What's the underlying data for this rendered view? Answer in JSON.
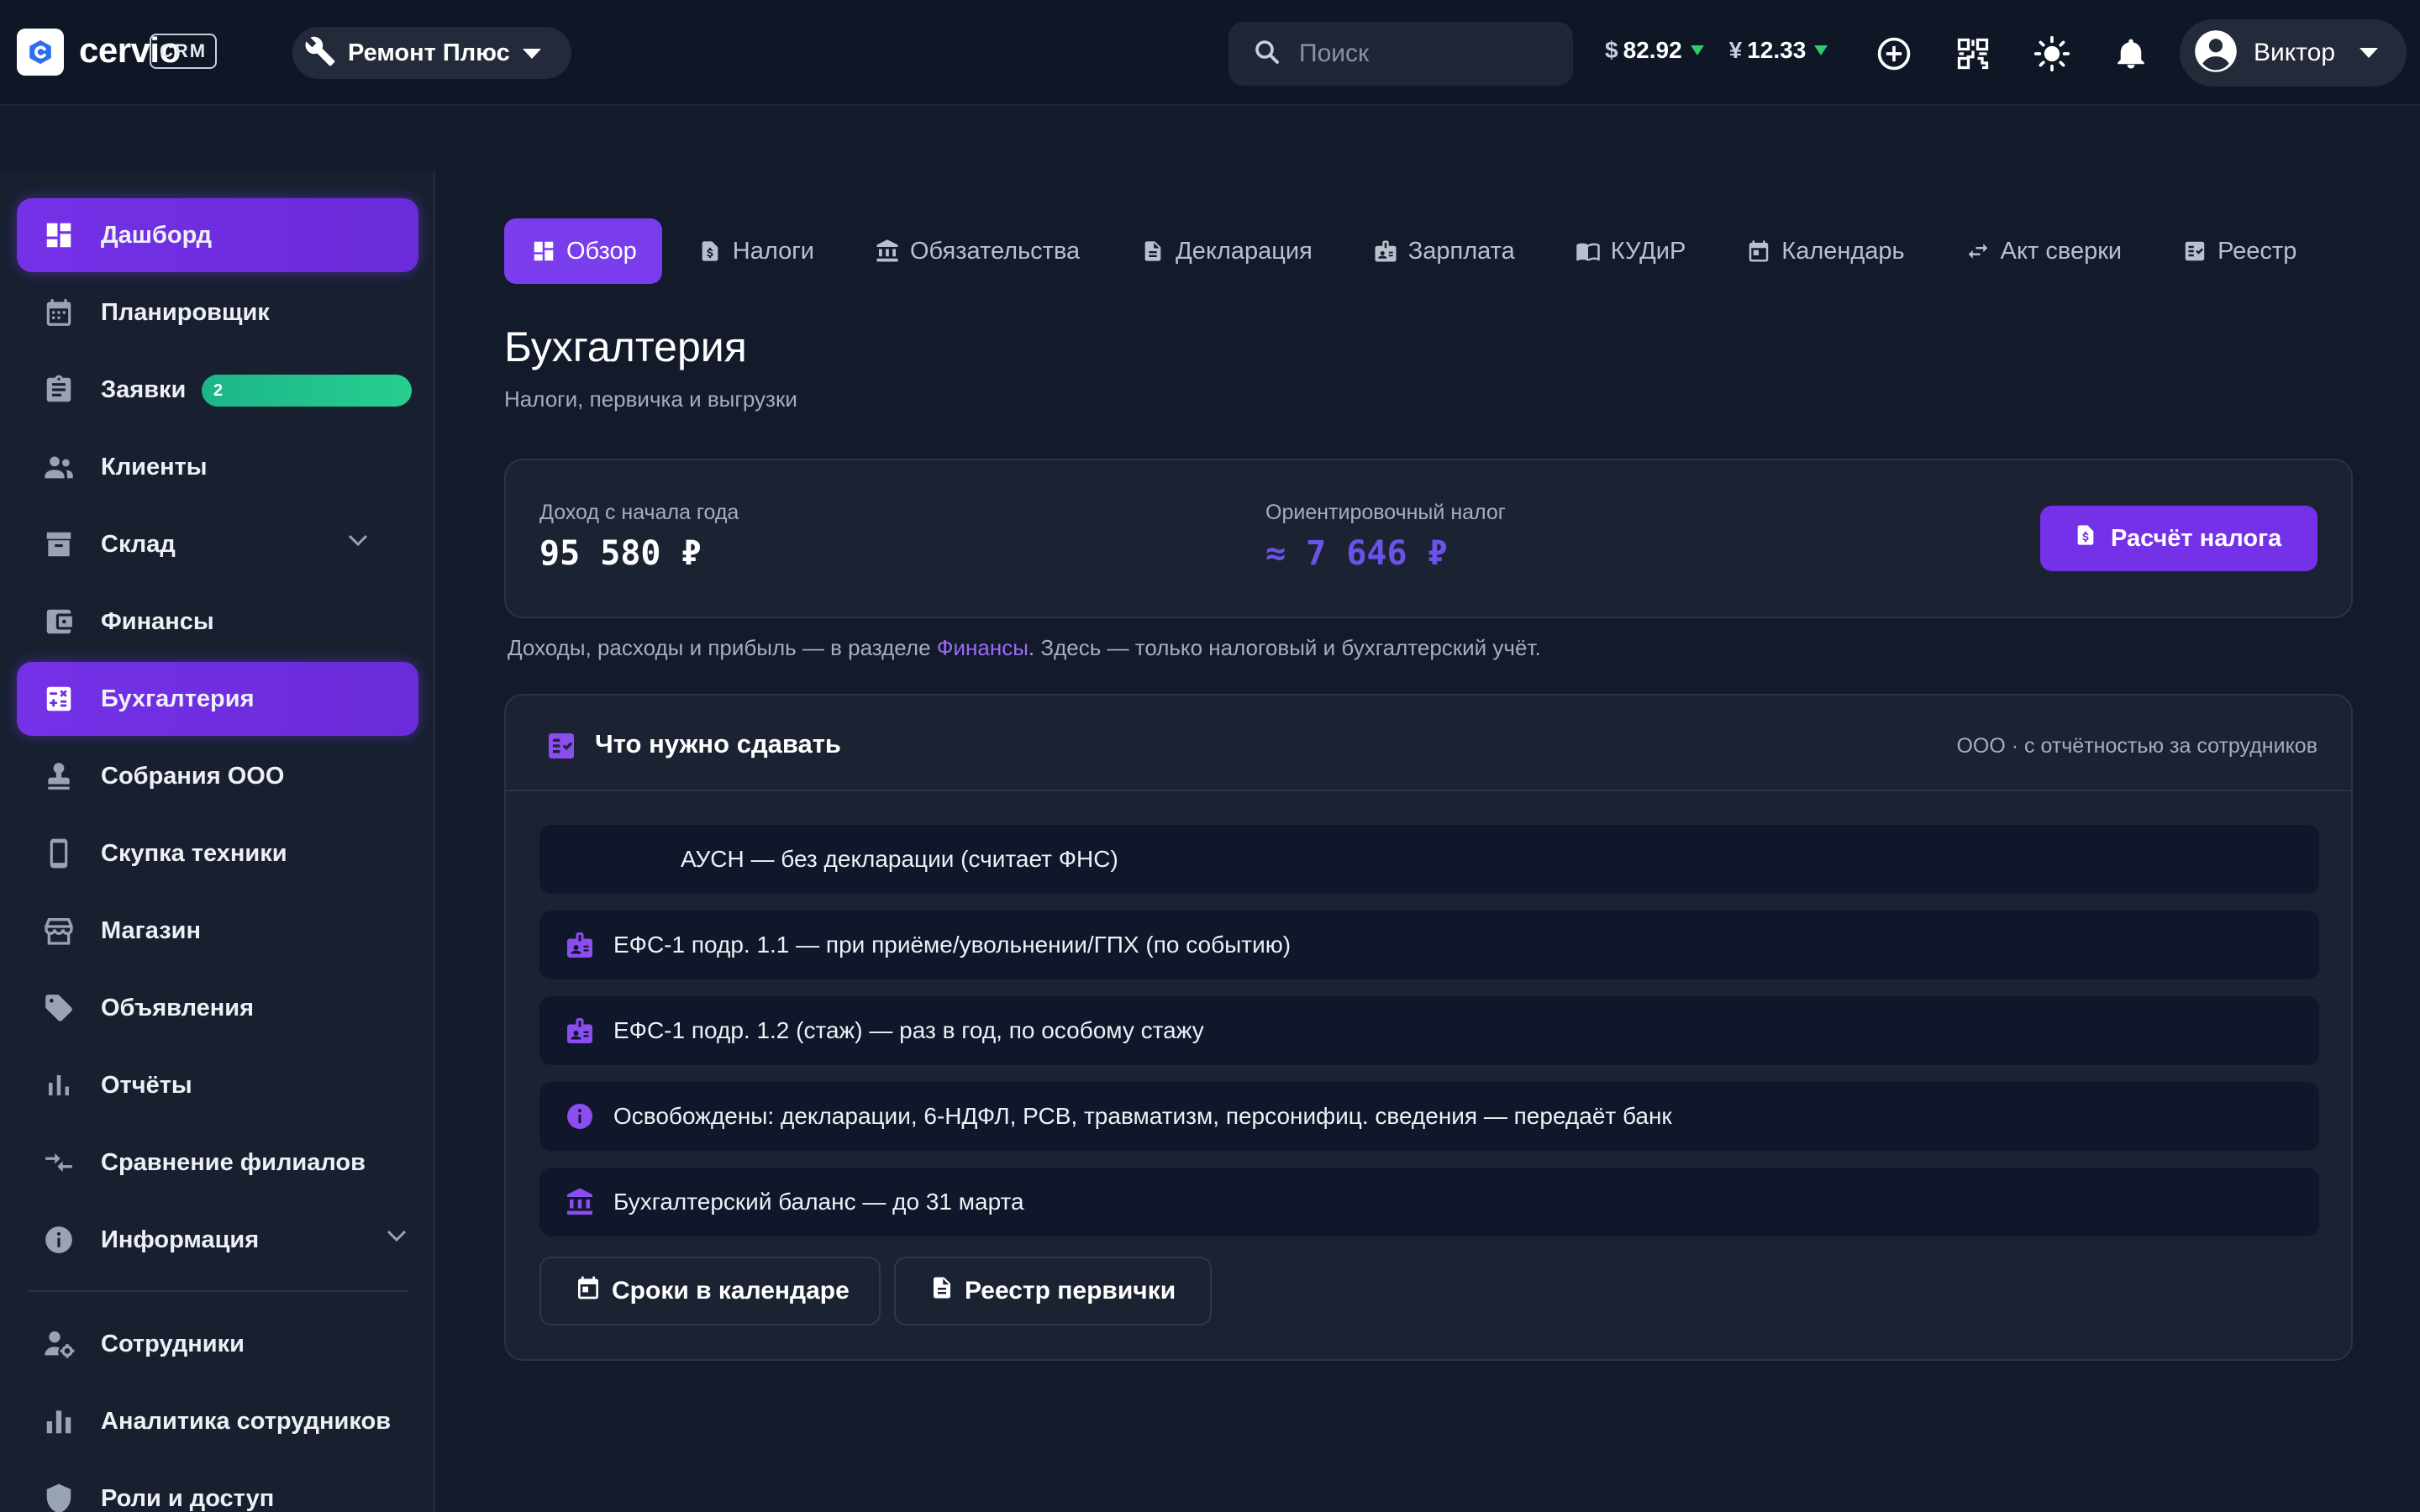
{
  "app": {
    "logo_text": "cervio",
    "badge": "CRM",
    "branch": "Ремонт Плюс",
    "search_placeholder": "Поиск",
    "rates": [
      {
        "symbol": "$",
        "value": "82.92",
        "trend": "down"
      },
      {
        "symbol": "¥",
        "value": "12.33",
        "trend": "down"
      }
    ],
    "user_name": "Виктор"
  },
  "sidebar": {
    "items": [
      {
        "label": "Дашборд",
        "icon": "dashboard-icon",
        "active": true
      },
      {
        "label": "Планировщик",
        "icon": "calendar-icon"
      },
      {
        "label": "Заявки",
        "icon": "clipboard-icon",
        "badge": "2"
      },
      {
        "label": "Клиенты",
        "icon": "people-icon"
      },
      {
        "label": "Склад",
        "icon": "archive-icon",
        "expandable": true
      },
      {
        "label": "Финансы",
        "icon": "wallet-icon"
      },
      {
        "label": "Бухгалтерия",
        "icon": "calculator-icon",
        "active": true
      },
      {
        "label": "Собрания ООО",
        "icon": "stamp-icon"
      },
      {
        "label": "Скупка техники",
        "icon": "phone-icon"
      },
      {
        "label": "Магазин",
        "icon": "store-icon"
      },
      {
        "label": "Объявления",
        "icon": "tag-icon"
      },
      {
        "label": "Отчёты",
        "icon": "bar-chart-icon"
      },
      {
        "label": "Сравнение филиалов",
        "icon": "compare-icon"
      },
      {
        "label": "Информация",
        "icon": "info-icon",
        "expandable": true
      },
      {
        "label": "Сотрудники",
        "icon": "staff-settings-icon"
      },
      {
        "label": "Аналитика сотрудников",
        "icon": "analytics-icon"
      },
      {
        "label": "Роли и доступ",
        "icon": "shield-icon"
      }
    ]
  },
  "tabs": [
    {
      "label": "Обзор",
      "icon": "dashboard-icon",
      "active": true
    },
    {
      "label": "Налоги",
      "icon": "tax-doc-icon"
    },
    {
      "label": "Обязательства",
      "icon": "bank-icon"
    },
    {
      "label": "Декларация",
      "icon": "document-icon"
    },
    {
      "label": "Зарплата",
      "icon": "badge-icon"
    },
    {
      "label": "КУДиР",
      "icon": "book-icon"
    },
    {
      "label": "Календарь",
      "icon": "calendar-icon"
    },
    {
      "label": "Акт сверки",
      "icon": "swap-icon"
    },
    {
      "label": "Реестр",
      "icon": "checklist-icon"
    }
  ],
  "page": {
    "title": "Бухгалтерия",
    "subtitle": "Налоги, первичка и выгрузки"
  },
  "kpi": {
    "income_label": "Доход с начала года",
    "income_value": "95 580 ₽",
    "tax_label": "Ориентировочный налог",
    "tax_value": "≈ 7 646 ₽",
    "calc_button": "Расчёт налога"
  },
  "note": {
    "before": "Доходы, расходы и прибыль — в разделе ",
    "link": "Финансы",
    "after": ". Здесь — только налоговый и бухгалтерский учёт."
  },
  "requirements": {
    "title": "Что нужно сдавать",
    "meta": "ООО · с отчётностью за сотрудников",
    "rows": [
      {
        "text": "АУСН — без декларации (считает ФНС)",
        "icon": ""
      },
      {
        "text": "ЕФС-1 подр. 1.1 — при приёме/увольнении/ГПХ (по событию)",
        "icon": "badge-icon"
      },
      {
        "text": "ЕФС-1 подр. 1.2 (стаж) — раз в год, по особому стажу",
        "icon": "badge-icon"
      },
      {
        "text": "Освобождены: декларации, 6-НДФЛ, РСВ, травматизм, персонифиц. сведения — передаёт банк",
        "icon": "info-icon"
      },
      {
        "text": "Бухгалтерский баланс — до 31 марта",
        "icon": "bank-icon"
      }
    ],
    "buttons": [
      {
        "label": "Сроки в календаре",
        "icon": "calendar-icon"
      },
      {
        "label": "Реестр первички",
        "icon": "document-icon"
      }
    ]
  },
  "colors": {
    "accent": "#7431e8",
    "badge_green": "#1cb58a",
    "tax_value": "#6b52e8",
    "background": "#131a29"
  }
}
